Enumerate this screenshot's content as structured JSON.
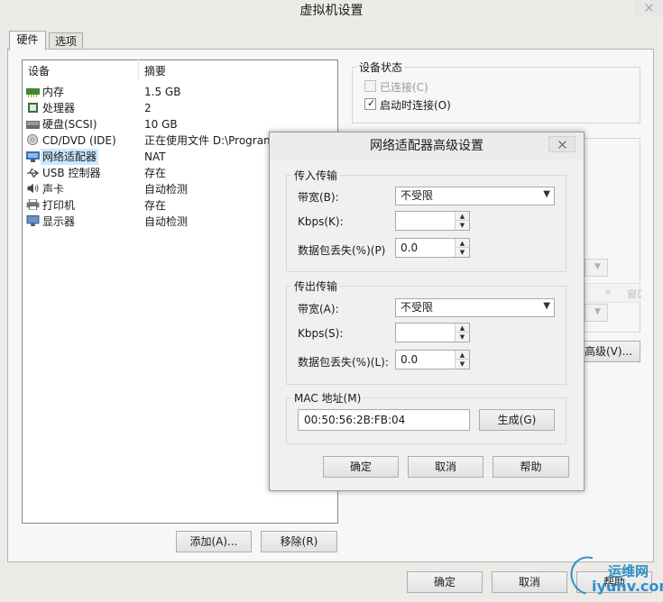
{
  "window": {
    "title": "虚拟机设置"
  },
  "tabs": [
    {
      "label": "硬件"
    },
    {
      "label": "选项"
    }
  ],
  "device_list": {
    "headers": {
      "device": "设备",
      "summary": "摘要"
    },
    "rows": [
      {
        "name": "内存",
        "summary": "1.5 GB",
        "icon": "memory-icon"
      },
      {
        "name": "处理器",
        "summary": "2",
        "icon": "processor-icon"
      },
      {
        "name": "硬盘(SCSI)",
        "summary": "10 GB",
        "icon": "harddisk-icon"
      },
      {
        "name": "CD/DVD (IDE)",
        "summary": "正在使用文件 D:\\Program",
        "icon": "cdrom-icon"
      },
      {
        "name": "网络适配器",
        "summary": "NAT",
        "icon": "network-icon",
        "selected": true
      },
      {
        "name": "USB 控制器",
        "summary": "存在",
        "icon": "usb-icon"
      },
      {
        "name": "声卡",
        "summary": "自动检测",
        "icon": "soundcard-icon"
      },
      {
        "name": "打印机",
        "summary": "存在",
        "icon": "printer-icon"
      },
      {
        "name": "显示器",
        "summary": "自动检测",
        "icon": "display-icon"
      }
    ],
    "add_label": "添加(A)...",
    "remove_label": "移除(R)"
  },
  "device_status": {
    "title": "设备状态",
    "connected_label": "已连接(C)",
    "connected_checked": false,
    "connect_at_poweron_label": "启动时连接(O)",
    "connect_at_poweron_checked": true
  },
  "right_panel": {
    "partial_text": "窗口副",
    "advanced_partial_label": "高级(V)..."
  },
  "footer": {
    "ok_label": "确定",
    "cancel_label": "取消",
    "help_label": "帮助"
  },
  "dialog": {
    "title": "网络适配器高级设置",
    "incoming": {
      "title": "传入传输",
      "bandwidth_label": "带宽(B):",
      "bandwidth_value": "不受限",
      "kbps_label": "Kbps(K):",
      "kbps_value": "",
      "loss_label": "数据包丢失(%)(P)",
      "loss_value": "0.0"
    },
    "outgoing": {
      "title": "传出传输",
      "bandwidth_label": "带宽(A):",
      "bandwidth_value": "不受限",
      "kbps_label": "Kbps(S):",
      "kbps_value": "",
      "loss_label": "数据包丢失(%)(L):",
      "loss_value": "0.0"
    },
    "mac": {
      "title": "MAC 地址(M)",
      "value": "00:50:56:2B:FB:04",
      "generate_label": "生成(G)"
    },
    "ok_label": "确定",
    "cancel_label": "取消",
    "help_label": "帮助"
  },
  "watermark": {
    "top_text": "运维网",
    "url_text": "iyunv.com"
  },
  "colors": {
    "selection": "#cce8ff",
    "watermark_blue": "#2e8fc8"
  }
}
